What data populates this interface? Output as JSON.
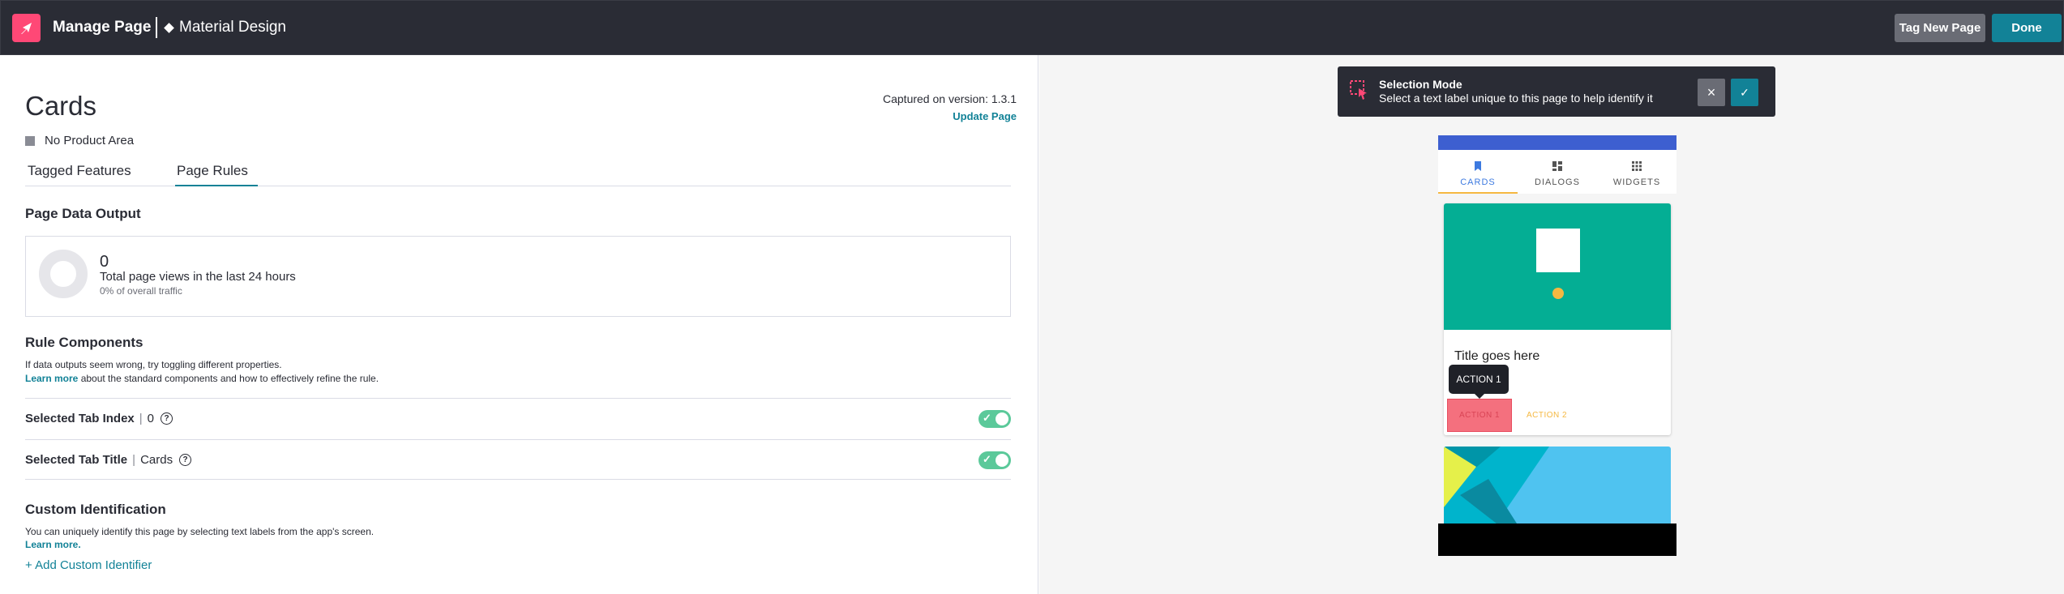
{
  "header": {
    "title": "Manage Page",
    "app_name": "Material Design",
    "tag_new_page": "Tag New Page",
    "done": "Done"
  },
  "page": {
    "name": "Cards",
    "product_area": "No Product Area",
    "captured": "Captured on version: 1.3.1",
    "update_link": "Update Page"
  },
  "tabs": [
    {
      "label": "Tagged Features",
      "active": false
    },
    {
      "label": "Page Rules",
      "active": true
    }
  ],
  "output": {
    "heading": "Page Data Output",
    "count": "0",
    "description": "Total page views in the last 24 hours",
    "share": "0% of overall traffic"
  },
  "rules": {
    "heading": "Rule Components",
    "hint": "If data outputs seem wrong, try toggling different properties.",
    "learn_link": "Learn more",
    "learn_rest": " about the standard components and how to effectively refine the rule.",
    "items": [
      {
        "label": "Selected Tab Index",
        "value": "0",
        "enabled": true
      },
      {
        "label": "Selected Tab Title",
        "value": "Cards",
        "enabled": true
      }
    ]
  },
  "custom": {
    "heading": "Custom Identification",
    "hint": "You can uniquely identify this page by selecting text labels from the app's screen.",
    "learn_link": "Learn more.",
    "add_link": "+ Add Custom Identifier"
  },
  "selection_banner": {
    "title": "Selection Mode",
    "subtitle": "Select a text label unique to this page to help identify it"
  },
  "preview": {
    "tabs": [
      {
        "label": "CARDS",
        "icon": "bookmark-icon",
        "active": true
      },
      {
        "label": "DIALOGS",
        "icon": "dashboard-icon",
        "active": false
      },
      {
        "label": "WIDGETS",
        "icon": "apps-icon",
        "active": false
      }
    ],
    "card_title": "Title goes here",
    "tooltip": "ACTION 1",
    "action1": "ACTION 1",
    "action2": "ACTION 2"
  },
  "colors": {
    "topbar": "#2a2c35",
    "accent": "#128297",
    "brand": "#ff4876",
    "toggle_on": "#5bc99a",
    "card_media": "#04ae94"
  }
}
